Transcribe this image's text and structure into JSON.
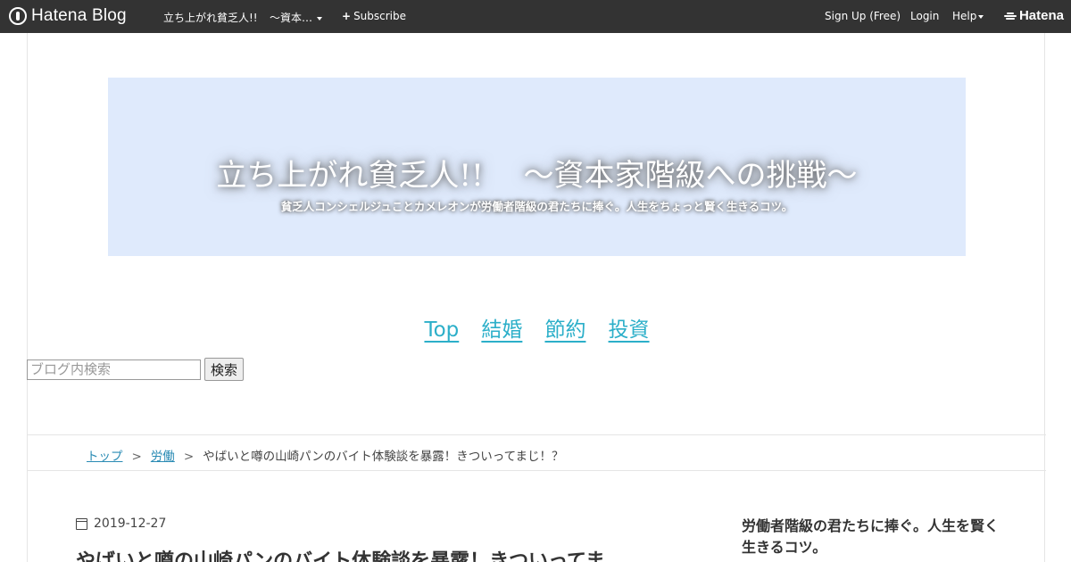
{
  "topbar": {
    "brand": "Hatena Blog",
    "blog_name": "立ち上がれ貧乏人!!",
    "blog_name_more": "～資本…",
    "subscribe": "Subscribe",
    "signup": "Sign Up (Free)",
    "login": "Login",
    "help": "Help",
    "hatena": "Hatena"
  },
  "header": {
    "title": "立ち上がれ貧乏人!!　 ～資本家階級への挑戦～",
    "description": "貧乏人コンシェルジュことカメレオンが労働者階級の君たちに捧ぐ。人生をちょっと賢く生きるコツ。"
  },
  "nav": [
    "Top",
    "結婚",
    "節約",
    "投資"
  ],
  "search": {
    "placeholder": "ブログ内検索",
    "button": "検索"
  },
  "breadcrumb": {
    "top": "トップ",
    "category": "労働",
    "current": "やばいと噂の山崎パンのバイト体験談を暴露！きついってまじ！？",
    "separator": ">"
  },
  "post": {
    "date": "2019-12-27",
    "title": "やばいと噂の山崎パンのバイト体験談を暴露！きついってま"
  },
  "sidebar": {
    "description": "労働者階級の君たちに捧ぐ。人生を賢く生きるコツ。"
  }
}
